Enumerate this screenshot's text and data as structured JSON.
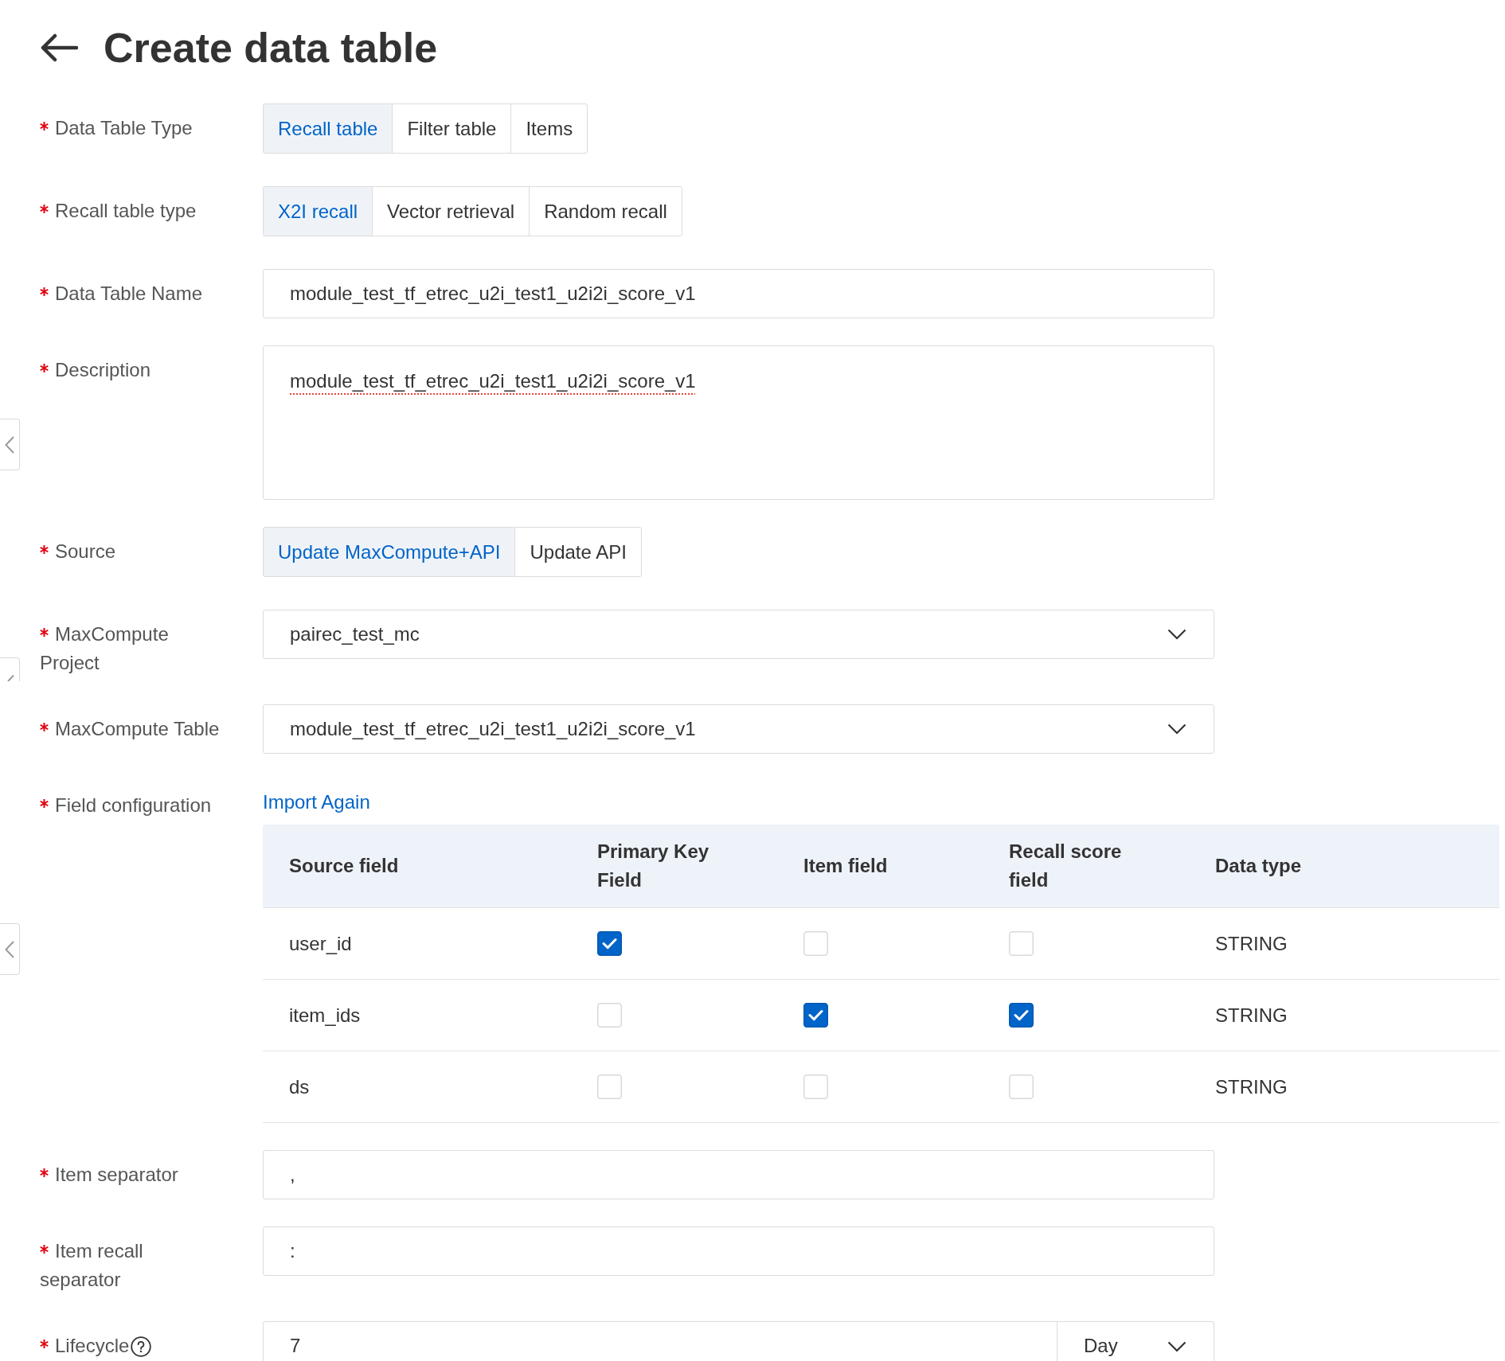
{
  "header": {
    "title": "Create data table"
  },
  "form": [
    {
      "kind": "segmented",
      "required": true,
      "label": "Data Table Type",
      "options": [
        {
          "label": "Recall table",
          "selected": true
        },
        {
          "label": "Filter table",
          "selected": false
        },
        {
          "label": "Items",
          "selected": false
        }
      ]
    },
    {
      "kind": "segmented",
      "required": true,
      "label": "Recall table type",
      "options": [
        {
          "label": "X2I recall",
          "selected": true
        },
        {
          "label": "Vector retrieval",
          "selected": false
        },
        {
          "label": "Random recall",
          "selected": false
        }
      ]
    },
    {
      "kind": "input",
      "required": true,
      "label": "Data Table Name",
      "value": "module_test_tf_etrec_u2i_test1_u2i2i_score_v1"
    },
    {
      "kind": "textarea",
      "required": true,
      "label": "Description",
      "value": "module_test_tf_etrec_u2i_test1_u2i2i_score_v1",
      "spellcheck_flagged": true
    },
    {
      "kind": "segmented",
      "required": true,
      "label": "Source",
      "options": [
        {
          "label": "Update MaxCompute+API",
          "selected": true
        },
        {
          "label": "Update API",
          "selected": false
        }
      ]
    },
    {
      "kind": "select",
      "required": true,
      "label": "MaxCompute Project",
      "value": "pairec_test_mc"
    },
    {
      "kind": "select",
      "required": true,
      "label": "MaxCompute Table",
      "value": "module_test_tf_etrec_u2i_test1_u2i2i_score_v1"
    },
    {
      "kind": "field_table",
      "required": true,
      "label": "Field configuration",
      "link": "Import Again",
      "table": {
        "columns": [
          "Source field",
          "Primary Key Field",
          "Item field",
          "Recall score field",
          "Data type"
        ],
        "rows": [
          {
            "source_field": "user_id",
            "checks": [
              {
                "checked": true
              },
              {
                "checked": false
              },
              {
                "checked": false
              }
            ],
            "data_type": "STRING"
          },
          {
            "source_field": "item_ids",
            "checks": [
              {
                "checked": false
              },
              {
                "checked": true
              },
              {
                "checked": true
              }
            ],
            "data_type": "STRING"
          },
          {
            "source_field": "ds",
            "checks": [
              {
                "checked": false
              },
              {
                "checked": false
              },
              {
                "checked": false
              }
            ],
            "data_type": "STRING"
          }
        ]
      }
    },
    {
      "kind": "input",
      "required": true,
      "label": "Item separator",
      "value": ","
    },
    {
      "kind": "input",
      "required": true,
      "label": "Item recall separator",
      "value": ":"
    },
    {
      "kind": "number_unit",
      "required": true,
      "label": "Lifecycle",
      "help": true,
      "value": "7",
      "unit": "Day"
    }
  ]
}
